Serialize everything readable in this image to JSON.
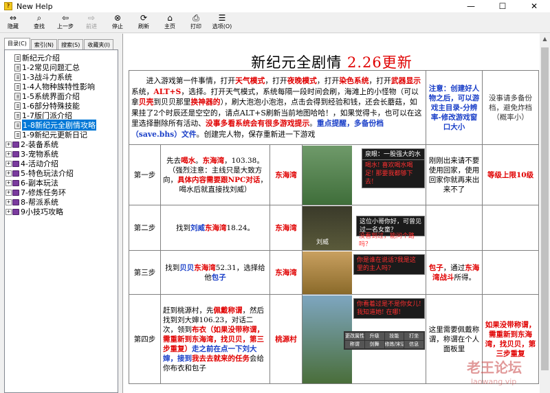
{
  "window": {
    "title": "New Help",
    "controls": [
      "—",
      "☐",
      "✕"
    ]
  },
  "toolbar": [
    {
      "label": "隐藏",
      "icon": "hide-icon",
      "glyph": "⇔",
      "enabled": true
    },
    {
      "label": "查找",
      "icon": "find-icon",
      "glyph": "⌕",
      "enabled": true
    },
    {
      "label": "上一步",
      "icon": "back-icon",
      "glyph": "⇦",
      "enabled": true
    },
    {
      "label": "前进",
      "icon": "forward-icon",
      "glyph": "⇨",
      "enabled": false
    },
    {
      "label": "停止",
      "icon": "stop-icon",
      "glyph": "⊗",
      "enabled": true
    },
    {
      "label": "刷新",
      "icon": "refresh-icon",
      "glyph": "⟳",
      "enabled": true
    },
    {
      "label": "主页",
      "icon": "home-icon",
      "glyph": "⌂",
      "enabled": true
    },
    {
      "label": "打印",
      "icon": "print-icon",
      "glyph": "⎙",
      "enabled": true
    },
    {
      "label": "选项(O)",
      "icon": "options-icon",
      "glyph": "☰",
      "enabled": true
    }
  ],
  "sidebar": {
    "tabs": [
      "目录(C)",
      "索引(N)",
      "搜索(S)",
      "收藏夹(I)"
    ],
    "active_tab": 0,
    "items": [
      {
        "label": "新纪元介绍",
        "type": "doc"
      },
      {
        "label": "1-2常见问题汇总",
        "type": "doc"
      },
      {
        "label": "1-3战斗力系统",
        "type": "doc"
      },
      {
        "label": "1-4人物种族特性影响",
        "type": "doc"
      },
      {
        "label": "1-5系统界面介绍",
        "type": "doc"
      },
      {
        "label": "1-6部分特殊技能",
        "type": "doc"
      },
      {
        "label": "1-7版门派介绍",
        "type": "doc"
      },
      {
        "label": "1-8新纪元全剧情攻略",
        "type": "doc",
        "selected": true
      },
      {
        "label": "1-9新纪元更新日记",
        "type": "doc"
      },
      {
        "label": "2-装备系统",
        "type": "book"
      },
      {
        "label": "3-宠物系统",
        "type": "book"
      },
      {
        "label": "4-活动介绍",
        "type": "book"
      },
      {
        "label": "5-特色玩法介绍",
        "type": "book"
      },
      {
        "label": "6-副本玩法",
        "type": "book"
      },
      {
        "label": "7-修炼任务环",
        "type": "book"
      },
      {
        "label": "8-帮派系统",
        "type": "book"
      },
      {
        "label": "9小技巧攻略",
        "type": "book"
      }
    ]
  },
  "page": {
    "heading_main": "新纪元全剧情",
    "heading_update": "2.26更新",
    "intro": [
      {
        "t": "进入游戏第一件事情，打开",
        "c": ""
      },
      {
        "t": "天气模式",
        "c": "r"
      },
      {
        "t": "，打开",
        "c": ""
      },
      {
        "t": "夜晚模式",
        "c": "r"
      },
      {
        "t": "，打开",
        "c": ""
      },
      {
        "t": "染色系统",
        "c": "r"
      },
      {
        "t": "，打开",
        "c": ""
      },
      {
        "t": "武器显示",
        "c": "r"
      },
      {
        "t": "系统，",
        "c": ""
      },
      {
        "t": "ALT+S",
        "c": "r"
      },
      {
        "t": "，选择。打开天气模式，系统每隔一段时间会刷，海滩上的小怪物（可以拿",
        "c": ""
      },
      {
        "t": "贝壳",
        "c": "r"
      },
      {
        "t": "到贝贝那里",
        "c": ""
      },
      {
        "t": "换神器的",
        "c": "r"
      },
      {
        "t": "），刷大泡泡小泡泡，点击会得到经验和钱，还会长蘑菇，如果挂了2个时辰还是空空的，请点ALT+S刷新当前地图哈哈！，如果觉得卡，也可以在这里选择删除所有活动、",
        "c": ""
      },
      {
        "t": "没事多看系统会有很多游戏提示",
        "c": "r"
      },
      {
        "t": "。",
        "c": ""
      },
      {
        "t": "重点提醒，多备份档（save.bhs）文件",
        "c": "b"
      },
      {
        "t": "。创建完人物，保存重新进一下游戏",
        "c": ""
      }
    ],
    "intro_note": "注意：创建好人物之后，可以游戏主目录-分辨率-修改游戏窗口大小",
    "intro_tip": "没事请多备份档，避免炸档（概率小）",
    "steps": [
      {
        "step": "第一步",
        "desc": [
          {
            "t": "先去",
            "c": ""
          },
          {
            "t": "喝水",
            "c": "r"
          },
          {
            "t": "。",
            "c": ""
          },
          {
            "t": "东海湾",
            "c": "r"
          },
          {
            "t": "，103.38。（强烈注意：主线只是大致方向，",
            "c": ""
          },
          {
            "t": "具体内容需要跟NPC对话",
            "c": "r"
          },
          {
            "t": "，喝水后就直接找刘威）",
            "c": ""
          }
        ],
        "location": "东海湾",
        "game_text": "泉眼：一股强大的水",
        "game_red": "喝水! 喜欢喝水喝足! 那要我都够下去!",
        "remark": "刚刚出来请不要使用回家，使用回家你就再来出来不了",
        "extra": "等级上限10级"
      },
      {
        "step": "第二步",
        "desc": [
          {
            "t": "找到",
            "c": ""
          },
          {
            "t": "刘威",
            "c": "b"
          },
          {
            "t": "东海湾",
            "c": "r"
          },
          {
            "t": "18.24。",
            "c": ""
          }
        ],
        "location": "东海湾",
        "game_text": "这位小哥你好，可曾见过一名女童？",
        "game_red": "没看到过，能问个路吗？",
        "npc_name": "刘威",
        "remark": "",
        "extra": ""
      },
      {
        "step": "第三步",
        "desc": [
          {
            "t": "找到",
            "c": ""
          },
          {
            "t": "贝贝",
            "c": "b"
          },
          {
            "t": "东海湾",
            "c": "r"
          },
          {
            "t": "52.31，选择给他",
            "c": ""
          },
          {
            "t": "包子",
            "c": "b"
          }
        ],
        "location": "东海湾",
        "game_red": "你是谁在说话?我是这里的主人吗?",
        "remark_parts": [
          {
            "t": "包子",
            "c": "r"
          },
          {
            "t": "，通过",
            "c": ""
          },
          {
            "t": "东海湾战斗",
            "c": "r"
          },
          {
            "t": "所得。",
            "c": ""
          }
        ],
        "extra": ""
      },
      {
        "step": "第四步",
        "desc": [
          {
            "t": "赶到桃源村，先",
            "c": ""
          },
          {
            "t": "佩戴称谓",
            "c": "r"
          },
          {
            "t": "，然后找到刘大婶106.23，对话二次，领到",
            "c": ""
          },
          {
            "t": "布衣（如果没带称谓，需重新到东海湾，找贝贝，第三步重复）",
            "c": "r"
          },
          {
            "t": "走之前在点一下刘大婶，接到",
            "c": "b"
          },
          {
            "t": "我去去就来的任务",
            "c": "r"
          },
          {
            "t": "会给你布衣和包子",
            "c": ""
          }
        ],
        "location": "桃源村",
        "game_red": "你看着过是不是你女儿! 我知道她! 在哪!",
        "menu_items": [
          "更改属性",
          "升级",
          "技能",
          "打坐",
          "称谓",
          "剑舞",
          "修炼/宋话",
          "信息"
        ],
        "remark": "这里需要佩戴称谓，称谓在个人面板里",
        "extra": "如果没带称谓，需重新到东海湾，找贝贝，第三步重复"
      }
    ],
    "watermark": "老王论坛",
    "watermark_sub": "laowang.vip"
  }
}
